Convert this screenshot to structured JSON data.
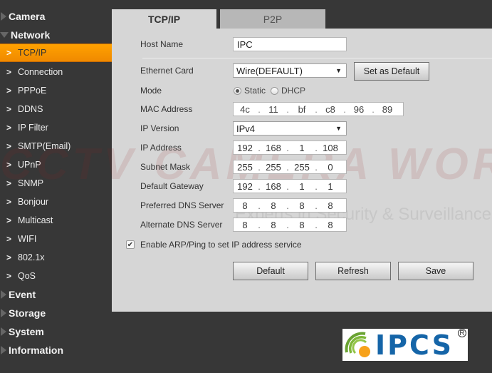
{
  "sidebar": {
    "categories": {
      "camera": "Camera",
      "network": "Network",
      "event": "Event",
      "storage": "Storage",
      "system": "System",
      "information": "Information"
    },
    "network_items": [
      {
        "label": "TCP/IP",
        "active": true
      },
      {
        "label": "Connection"
      },
      {
        "label": "PPPoE"
      },
      {
        "label": "DDNS"
      },
      {
        "label": "IP Filter"
      },
      {
        "label": "SMTP(Email)"
      },
      {
        "label": "UPnP"
      },
      {
        "label": "SNMP"
      },
      {
        "label": "Bonjour"
      },
      {
        "label": "Multicast"
      },
      {
        "label": "WIFI"
      },
      {
        "label": "802.1x"
      },
      {
        "label": "QoS"
      }
    ],
    "chevron_glyph": ">"
  },
  "tabs": [
    {
      "label": "TCP/IP",
      "active": true
    },
    {
      "label": "P2P",
      "active": false
    }
  ],
  "form": {
    "host_name": {
      "label": "Host Name",
      "value": "IPC"
    },
    "ethernet_card": {
      "label": "Ethernet Card",
      "value": "Wire(DEFAULT)",
      "set_default_label": "Set as Default"
    },
    "mode": {
      "label": "Mode",
      "options": [
        "Static",
        "DHCP"
      ],
      "selected": "Static"
    },
    "mac_address": {
      "label": "MAC Address",
      "octets": [
        "4c",
        "11",
        "bf",
        "c8",
        "96",
        "89"
      ]
    },
    "ip_version": {
      "label": "IP Version",
      "value": "IPv4"
    },
    "ip_address": {
      "label": "IP Address",
      "octets": [
        "192",
        "168",
        "1",
        "108"
      ]
    },
    "subnet_mask": {
      "label": "Subnet Mask",
      "octets": [
        "255",
        "255",
        "255",
        "0"
      ]
    },
    "default_gateway": {
      "label": "Default Gateway",
      "octets": [
        "192",
        "168",
        "1",
        "1"
      ]
    },
    "preferred_dns": {
      "label": "Preferred DNS Server",
      "octets": [
        "8",
        "8",
        "8",
        "8"
      ]
    },
    "alternate_dns": {
      "label": "Alternate DNS Server",
      "octets": [
        "8",
        "8",
        "8",
        "8"
      ]
    },
    "arp_ping": {
      "label": "Enable ARP/Ping to set IP address service",
      "checked": true
    }
  },
  "buttons": {
    "default": "Default",
    "refresh": "Refresh",
    "save": "Save"
  },
  "watermark": {
    "title": "CCTV CAMERA WORLD",
    "tagline": "Experts in Security & Surveillance Systems"
  },
  "logo": {
    "text": "IPCS",
    "registered": "R"
  },
  "colors": {
    "accent": "#f59400",
    "sidebar_bg": "#373737",
    "panel_bg": "#d6d6d6",
    "logo_blue": "#1565a8"
  }
}
